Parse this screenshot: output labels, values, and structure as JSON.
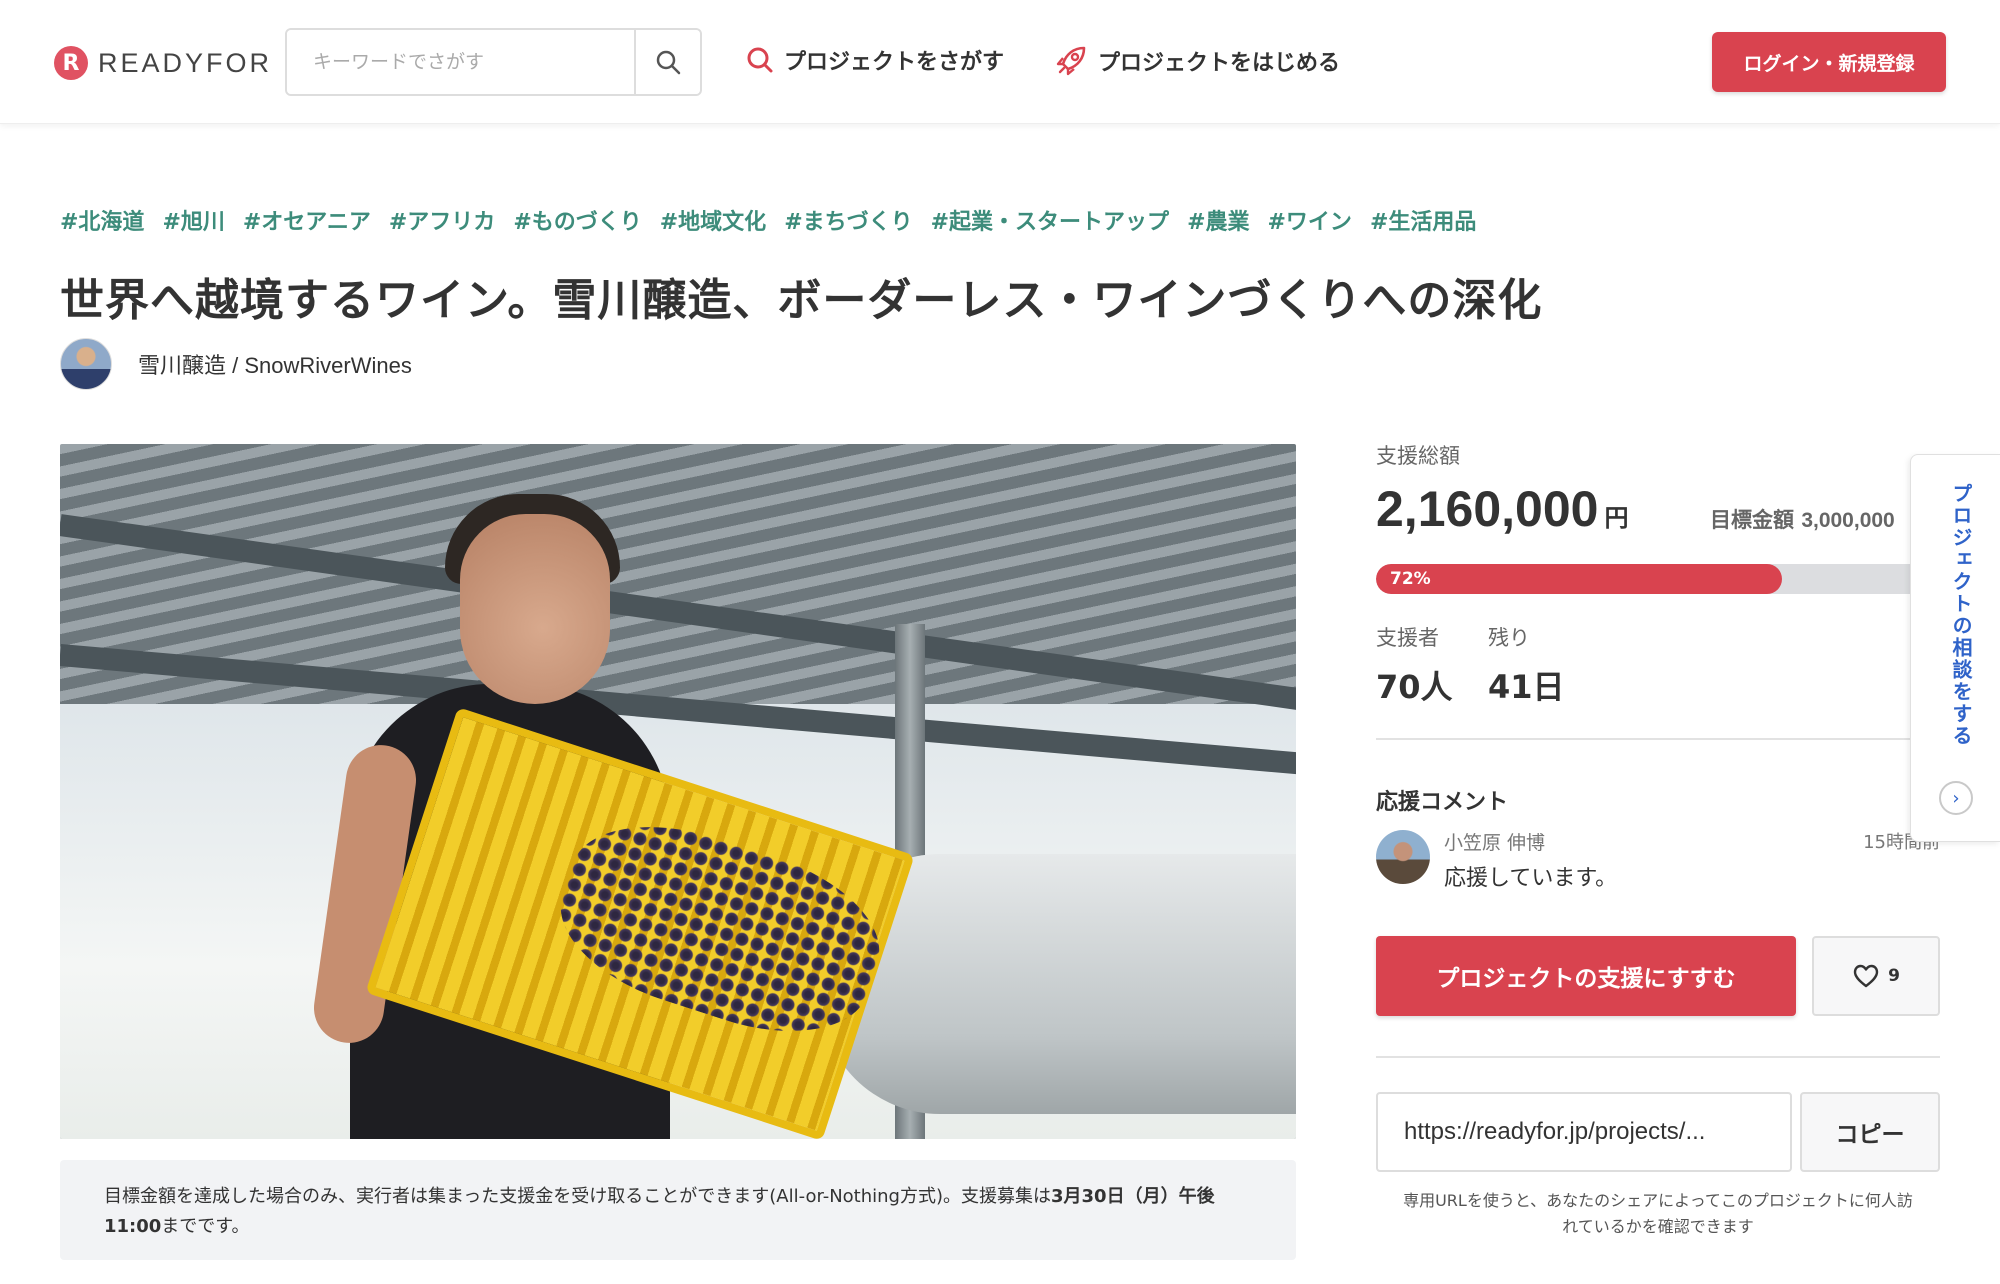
{
  "header": {
    "logo_text": "READYFOR",
    "logo_mark": "R",
    "search_placeholder": "キーワードでさがす",
    "nav_find": "プロジェクトをさがす",
    "nav_start": "プロジェクトをはじめる",
    "login_label": "ログイン・新規登録"
  },
  "project": {
    "tags": [
      "#北海道",
      "#旭川",
      "#オセアニア",
      "#アフリカ",
      "#ものづくり",
      "#地域文化",
      "#まちづくり",
      "#起業・スタートアップ",
      "#農業",
      "#ワイン",
      "#生活用品"
    ],
    "title": "世界へ越境するワイン。雪川醸造、ボーダーレス・ワインづくりへの深化",
    "owner": "雪川醸造 / SnowRiverWines",
    "notice_normal": "目標金額を達成した場合のみ、実行者は集まった支援金を受け取ることができます(All-or-Nothing方式)。支援募集は",
    "notice_bold": "3月30日（月）午後11:00",
    "notice_end": "までです。"
  },
  "funding": {
    "total_label": "支援総額",
    "total_amount": "2,160,000",
    "currency": "円",
    "goal_label": "目標金額",
    "goal_amount": "3,000,000",
    "progress_percent": 72,
    "progress_label": "72%",
    "supporters_label": "支援者",
    "supporters_value": "70人",
    "remaining_label": "残り",
    "remaining_value": "41日"
  },
  "comments": {
    "title": "応援コメント",
    "items": [
      {
        "name": "小笠原 伸博",
        "time": "15時間前",
        "text": "応援しています。"
      }
    ]
  },
  "actions": {
    "support_label": "プロジェクトの支援にすすむ",
    "favorite_count": "9",
    "share_url": "https://readyfor.jp/projects/...",
    "copy_label": "コピー",
    "url_help": "専用URLを使うと、あなたのシェアによってこのプロジェクトに何人訪れているかを確認できます"
  },
  "floating_tab": {
    "label": "プロジェクトの相談をする",
    "arrow": "›"
  },
  "colors": {
    "brand": "#d9434f",
    "tag": "#3d8c7b",
    "float_text": "#2f63c9"
  }
}
